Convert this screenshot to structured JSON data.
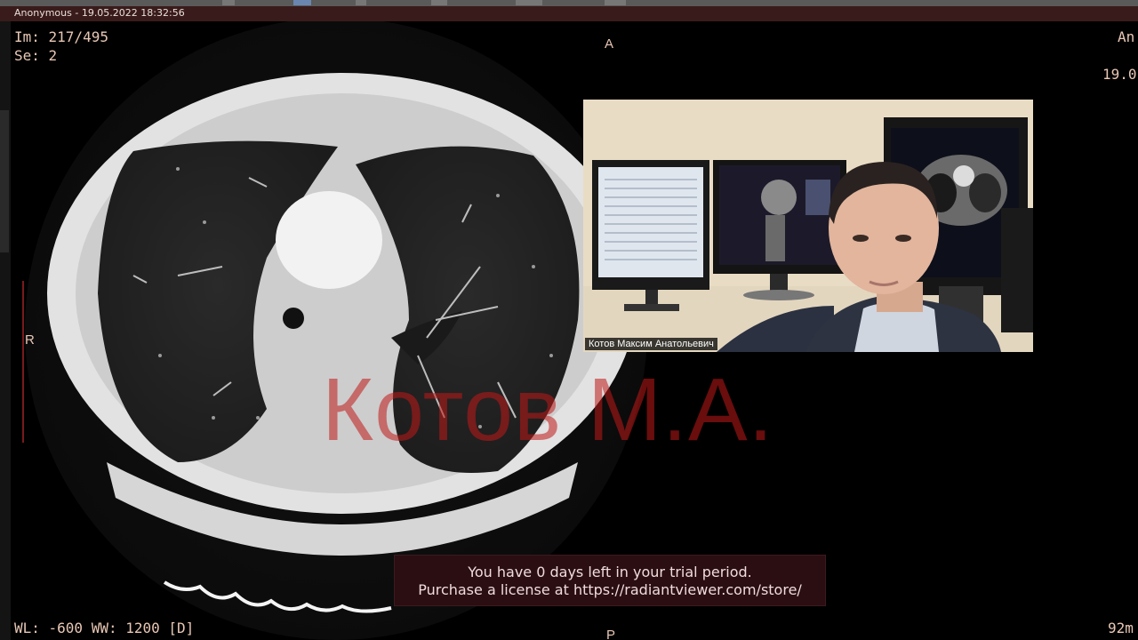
{
  "window": {
    "title": "Anonymous - 19.05.2022 18:32:56"
  },
  "overlay": {
    "image_index": "Im: 217/495",
    "series": "Se: 2",
    "window_level": "WL: -600 WW: 1200 [D]",
    "top_right_name": "An",
    "top_right_date": "19.0",
    "bottom_right": "92m"
  },
  "orientation": {
    "top": "A",
    "bottom": "P",
    "left": "R"
  },
  "watermark": "Котов М.А.",
  "trial_notice": {
    "line1": "You have 0 days left in your trial period.",
    "line2": "Purchase a license at https://radiantviewer.com/store/"
  },
  "webcam": {
    "name": "Котов Максим Анатольевич"
  }
}
